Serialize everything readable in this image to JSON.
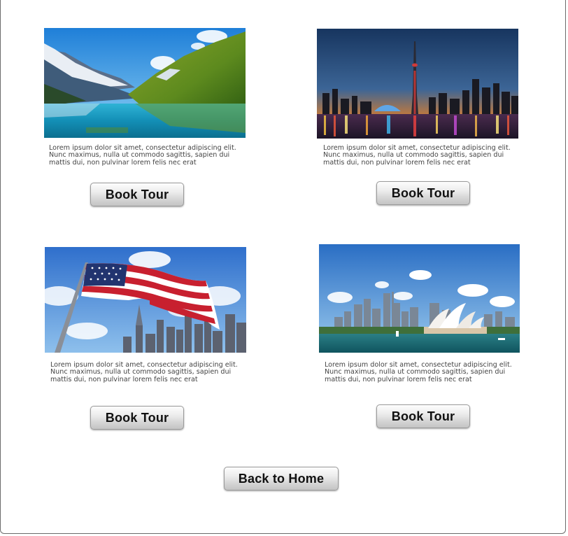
{
  "tours": [
    {
      "image_alt": "Mountain lake with snowy peaks",
      "description": "Lorem ipsum dolor sit amet, consectetur adipiscing elit. Nunc maximus, nulla ut commodo sagittis, sapien dui mattis dui, non pulvinar lorem felis nec erat",
      "button_label": "Book Tour"
    },
    {
      "image_alt": "City skyline at night with tower",
      "description": "Lorem ipsum dolor sit amet, consectetur adipiscing elit. Nunc maximus, nulla ut commodo sagittis, sapien dui mattis dui, non pulvinar lorem felis nec erat",
      "button_label": "Book Tour"
    },
    {
      "image_alt": "American flag over city skyline",
      "description": "Lorem ipsum dolor sit amet, consectetur adipiscing elit. Nunc maximus, nulla ut commodo sagittis, sapien dui mattis dui, non pulvinar lorem felis nec erat",
      "button_label": "Book Tour"
    },
    {
      "image_alt": "Harbour skyline with opera house",
      "description": "Lorem ipsum dolor sit amet, consectetur adipiscing elit. Nunc maximus, nulla ut commodo sagittis, sapien dui mattis dui, non pulvinar lorem felis nec erat",
      "button_label": "Book Tour"
    }
  ],
  "back_button_label": "Back to Home"
}
